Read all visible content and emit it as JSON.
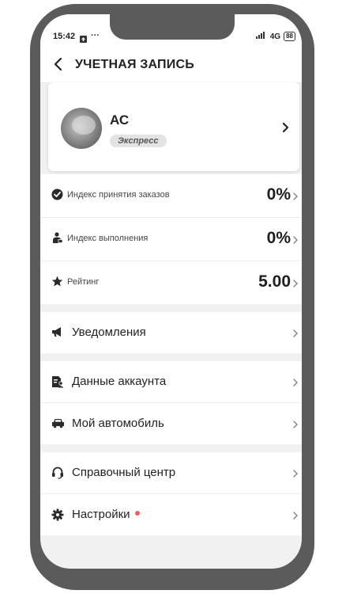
{
  "status_bar": {
    "time": "15:42",
    "network": "4G",
    "battery": "88"
  },
  "header": {
    "title": "УЧЕТНАЯ ЗАПИСЬ"
  },
  "profile": {
    "name": "АС",
    "badge": "Экспресс"
  },
  "metrics": [
    {
      "icon": "check-circle-icon",
      "label": "Индекс принятия заказов",
      "value": "0%"
    },
    {
      "icon": "courier-icon",
      "label": "Индекс выполнения",
      "value": "0%"
    },
    {
      "icon": "star-icon",
      "label": "Рейтинг",
      "value": "5.00"
    }
  ],
  "menu": {
    "notifications": "Уведомления",
    "account_data": "Данные аккаунта",
    "my_car": "Мой автомобиль",
    "help_center": "Справочный центр",
    "settings": "Настройки"
  },
  "colors": {
    "frame": "#5b5b5b",
    "background": "#f1f1f1",
    "notification_dot": "#e86060"
  }
}
